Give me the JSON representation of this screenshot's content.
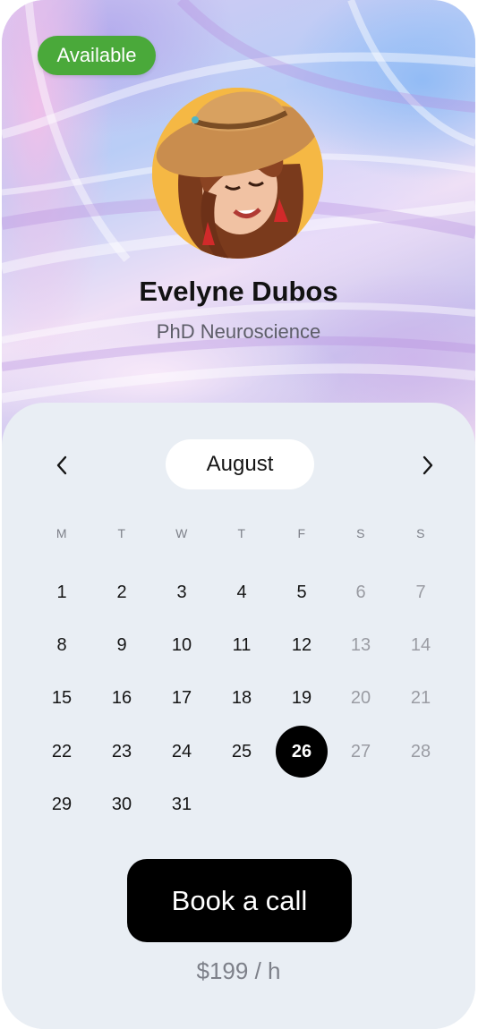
{
  "profile": {
    "status_badge": "Available",
    "name": "Evelyne Dubos",
    "subtitle": "PhD Neuroscience"
  },
  "calendar": {
    "month": "August",
    "weekdays": [
      "M",
      "T",
      "W",
      "T",
      "F",
      "S",
      "S"
    ],
    "weeks": [
      [
        1,
        2,
        3,
        4,
        5,
        6,
        7
      ],
      [
        8,
        9,
        10,
        11,
        12,
        13,
        14
      ],
      [
        15,
        16,
        17,
        18,
        19,
        20,
        21
      ],
      [
        22,
        23,
        24,
        25,
        26,
        27,
        28
      ],
      [
        29,
        30,
        31
      ]
    ],
    "selected_day": 26,
    "prev_icon": "chevron-left-icon",
    "next_icon": "chevron-right-icon"
  },
  "booking": {
    "button_label": "Book a call",
    "price": "$199 / h"
  },
  "colors": {
    "badge": "#4aa93a",
    "selected_day_bg": "#000000",
    "weekend_text": "#9a9ca3",
    "sheet_bg": "#e9eef4"
  }
}
